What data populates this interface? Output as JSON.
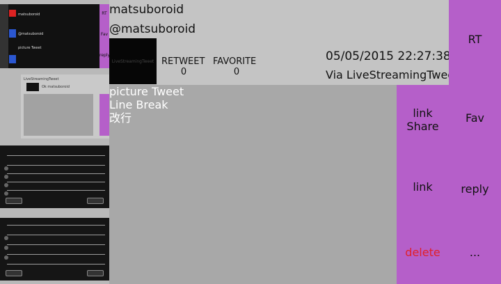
{
  "tweet": {
    "screen_name": "matsuboroid",
    "user_id": "@matsuboroid",
    "thumbnail_label": "LiveStreamingTweet",
    "retweet_label": "RETWEET",
    "retweet_count": "0",
    "favorite_label": "FAVORITE",
    "favorite_count": "0",
    "timestamp": "05/05/2015 22:27:38",
    "via": "Via LiveStreamingTweet",
    "body": "picture Tweet\nLine Break\n改行"
  },
  "actions": {
    "link_share": "link\nShare",
    "link": "link",
    "delete": "delete",
    "rt": "RT",
    "fav": "Fav",
    "reply": "reply",
    "more": "..."
  },
  "thumbs": {
    "t1_side": [
      "RT",
      "Fav",
      "reply"
    ],
    "t1_lines": [
      "matsuboroid",
      "@matsuboroid",
      "picture Tweet"
    ],
    "t2_lines": [
      "LiveStreamingTweet",
      "Ok matsuboroid"
    ]
  },
  "colors": {
    "accent": "#b55fc9",
    "background": "#a8a8a8",
    "header": "#c4c4c4",
    "delete": "#e0202a"
  }
}
